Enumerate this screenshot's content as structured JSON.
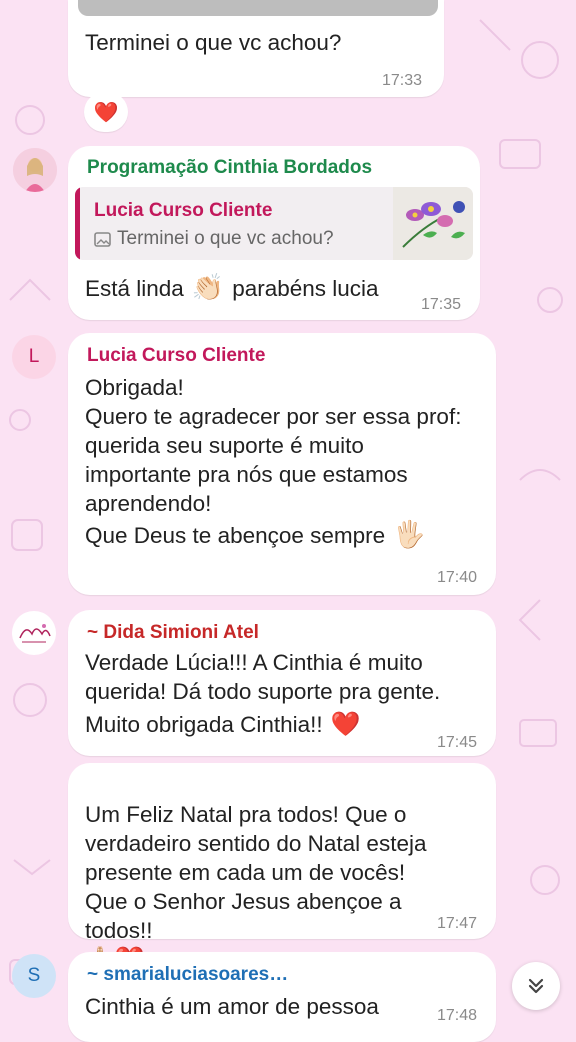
{
  "messages": {
    "m1": {
      "text": "Terminei o que vc achou?",
      "time": "17:33",
      "reaction": "❤️"
    },
    "m2": {
      "sender": "Programação Cinthia Bordados",
      "quote_sender": "Lucia Curso Cliente",
      "quote_text": "Terminei o que vc achou?",
      "text": "Está linda",
      "emoji": "👏🏻",
      "text_after": "parabéns lucia",
      "time": "17:35"
    },
    "m3": {
      "avatar_letter": "L",
      "sender": "Lucia Curso Cliente",
      "text": "Obrigada!\nQuero te agradecer por ser essa prof: querida seu suporte é muito importante pra nós que estamos aprendendo!",
      "text2": "Que Deus te abençoe sempre",
      "emoji": "🖐🏻",
      "time": "17:40"
    },
    "m4": {
      "sender": "~ Dida Simioni Atel",
      "text": "Verdade Lúcia!!! A Cinthia é muito querida! Dá todo suporte pra gente.",
      "text2": "Muito obrigada Cinthia!!",
      "emoji": "❤️",
      "time": "17:45"
    },
    "m5": {
      "text": "Um Feliz Natal pra todos! Que o verdadeiro sentido do Natal esteja presente em cada um de vocês! Que o Senhor Jesus abençoe a todos!!",
      "emoji": "🙏🏻❤️",
      "time": "17:47"
    },
    "m6": {
      "avatar_letter": "S",
      "sender": "~ smarialuciasoares…",
      "text": "Cinthia é um amor de pessoa",
      "time": "17:48"
    }
  },
  "colors": {
    "wallpaper": "#fbe2f3",
    "sender_green": "#1e8a4c",
    "sender_pink": "#c2185b",
    "sender_red": "#c62828",
    "sender_blue": "#1f6fb5"
  },
  "icons": {
    "scroll_down": "chevron-double-down-icon",
    "photo": "image-icon"
  }
}
